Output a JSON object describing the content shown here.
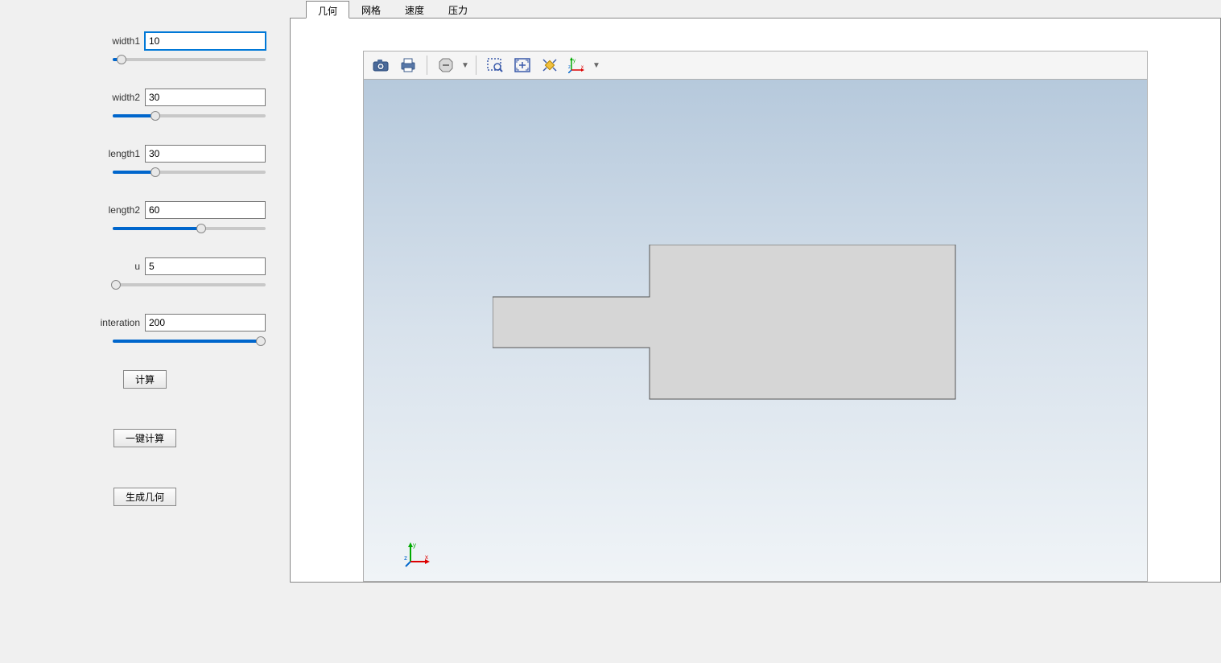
{
  "sidebar": {
    "params": [
      {
        "label": "width1",
        "value": "10",
        "sliderPercent": 6,
        "selected": true
      },
      {
        "label": "width2",
        "value": "30",
        "sliderPercent": 28,
        "selected": false
      },
      {
        "label": "length1",
        "value": "30",
        "sliderPercent": 28,
        "selected": false
      },
      {
        "label": "length2",
        "value": "60",
        "sliderPercent": 58,
        "selected": false
      },
      {
        "label": "u",
        "value": "5",
        "sliderPercent": 2,
        "selected": false
      },
      {
        "label": "interation",
        "value": "200",
        "sliderPercent": 97,
        "selected": false
      }
    ],
    "buttons": {
      "compute": "计算",
      "oneClick": "一键计算",
      "generate": "生成几何"
    }
  },
  "tabs": [
    {
      "label": "几何",
      "active": true
    },
    {
      "label": "网格",
      "active": false
    },
    {
      "label": "速度",
      "active": false
    },
    {
      "label": "压力",
      "active": false
    }
  ],
  "toolbar": {
    "icons": [
      "camera-icon",
      "print-icon",
      "sep",
      "disable-icon",
      "dropdown",
      "sep",
      "zoom-box-icon",
      "zoom-extents-icon",
      "zoom-selection-icon",
      "axes-icon",
      "dropdown"
    ]
  },
  "axisLabels": {
    "x": "x",
    "y": "y",
    "z": "z"
  }
}
